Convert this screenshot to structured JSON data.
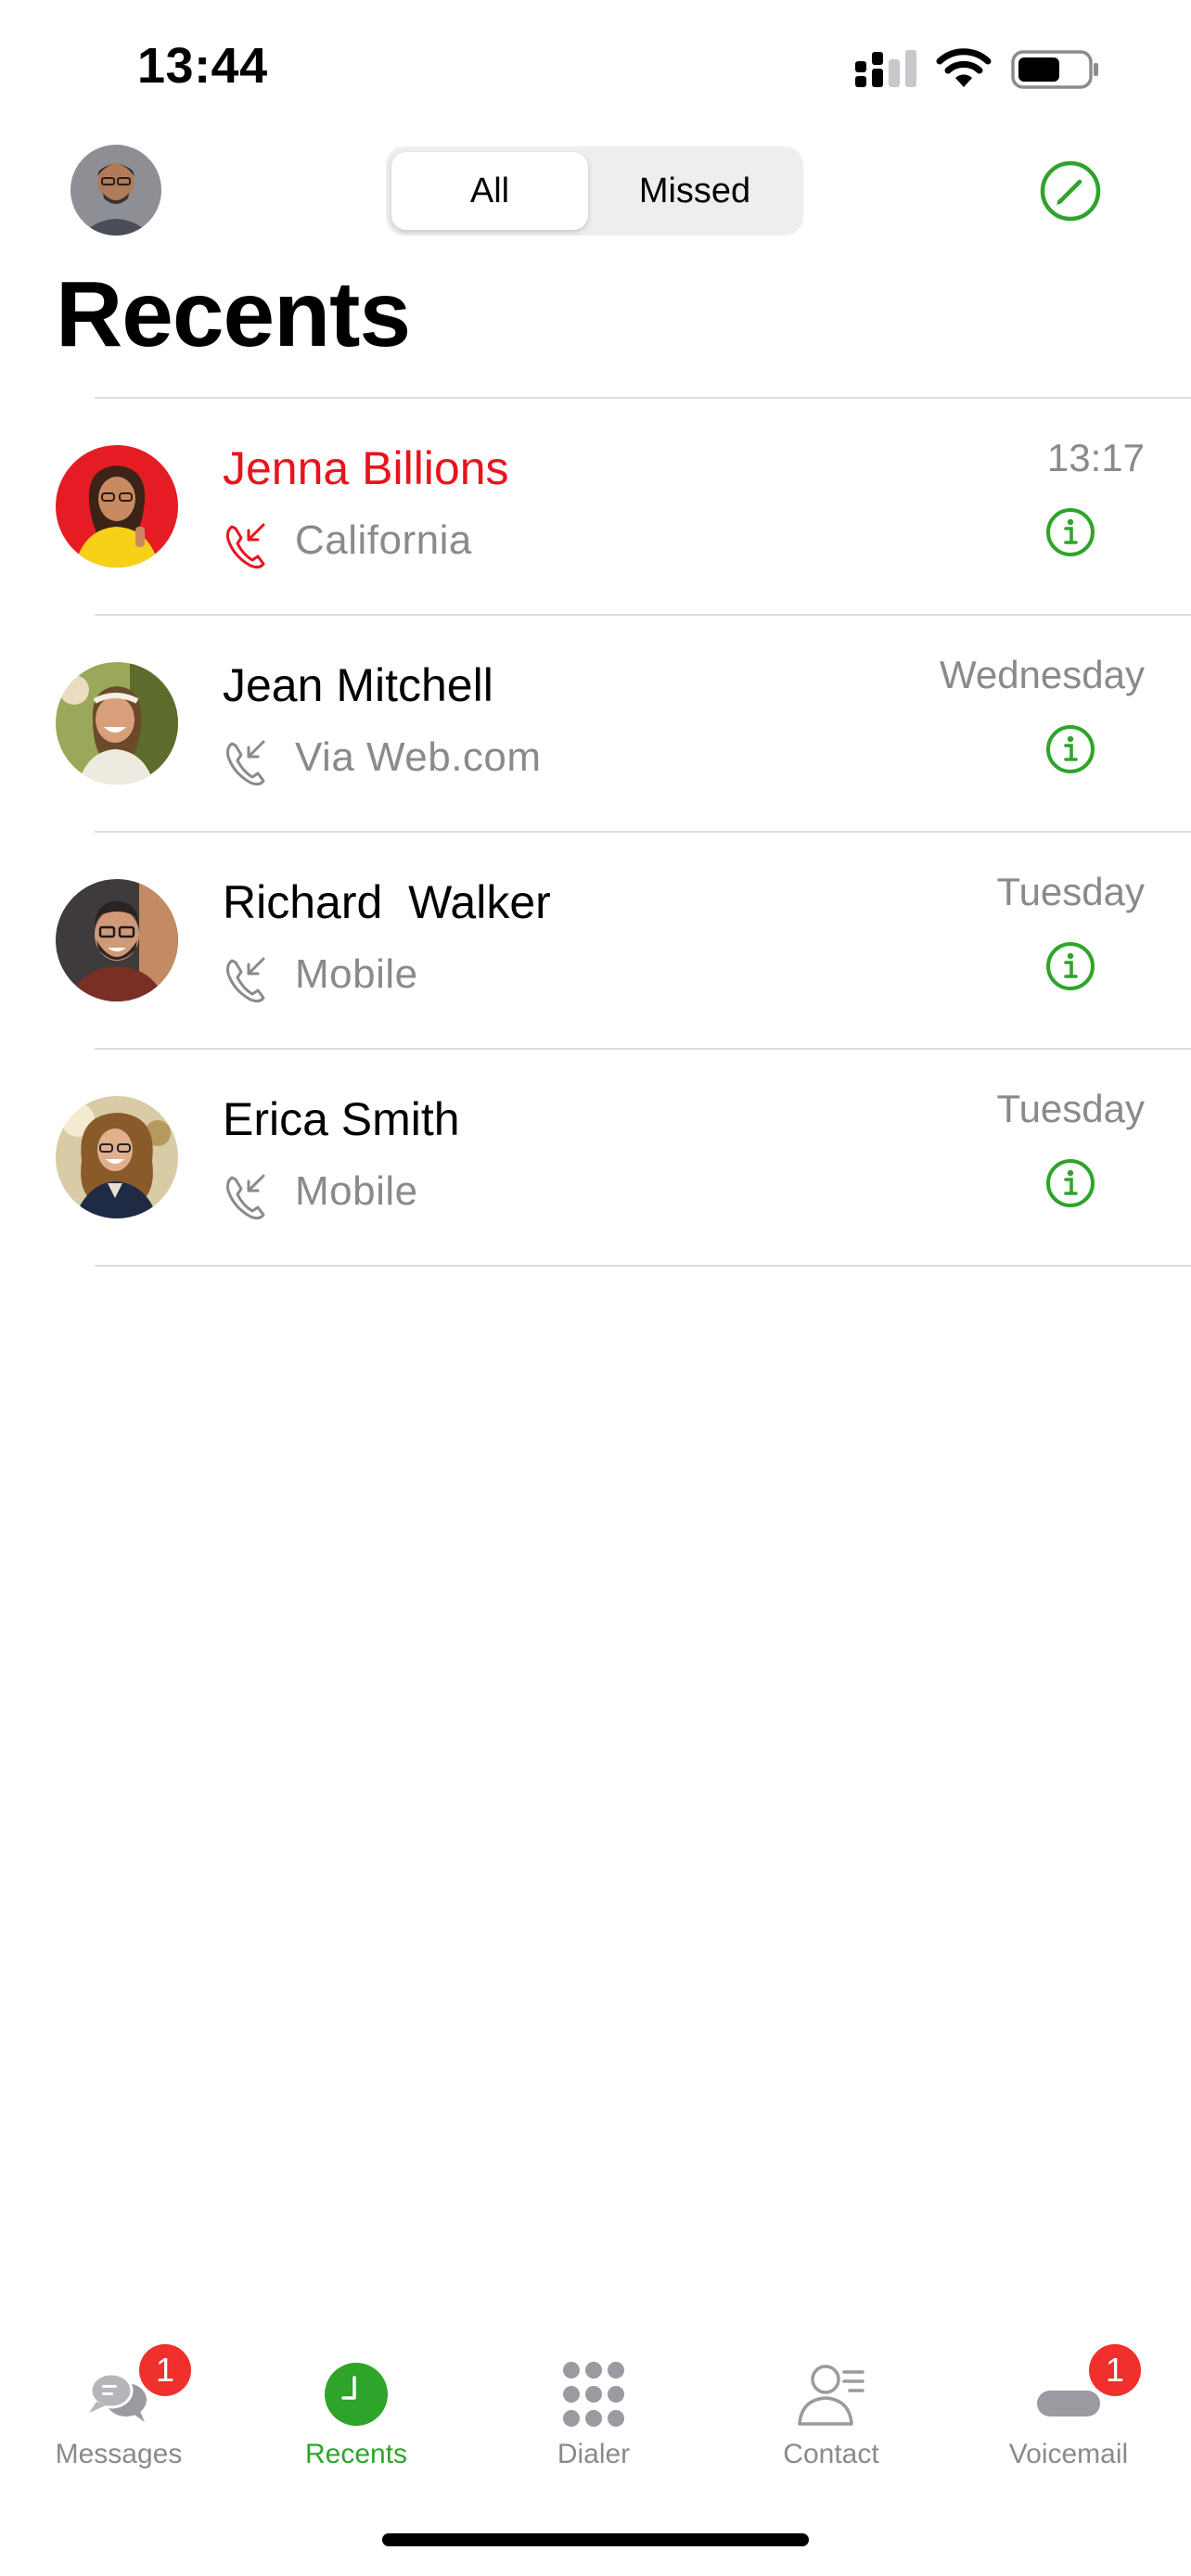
{
  "status_bar": {
    "time": "13:44"
  },
  "header": {
    "segments": [
      {
        "label": "All",
        "selected": true
      },
      {
        "label": "Missed",
        "selected": false
      }
    ],
    "title": "Recents"
  },
  "colors": {
    "accent_green": "#2ea42b",
    "missed_red": "#e8141c",
    "secondary_gray": "#8a8a8e",
    "badge_red": "#f0302c"
  },
  "calls": [
    {
      "name": "Jenna Billions",
      "sub": "California",
      "time": "13:17",
      "missed": true
    },
    {
      "name": "Jean Mitchell",
      "sub": "Via Web.com",
      "time": "Wednesday",
      "missed": false
    },
    {
      "name": "Richard  Walker",
      "sub": "Mobile",
      "time": "Tuesday",
      "missed": false
    },
    {
      "name": "Erica Smith",
      "sub": "Mobile",
      "time": "Tuesday",
      "missed": false
    }
  ],
  "tabs": [
    {
      "label": "Messages",
      "icon": "messages-icon",
      "badge": "1",
      "active": false
    },
    {
      "label": "Recents",
      "icon": "clock-icon",
      "active": true
    },
    {
      "label": "Dialer",
      "icon": "dialpad-icon",
      "active": false
    },
    {
      "label": "Contact",
      "icon": "contact-icon",
      "active": false
    },
    {
      "label": "Voicemail",
      "icon": "voicemail-icon",
      "badge": "1",
      "active": false
    }
  ]
}
